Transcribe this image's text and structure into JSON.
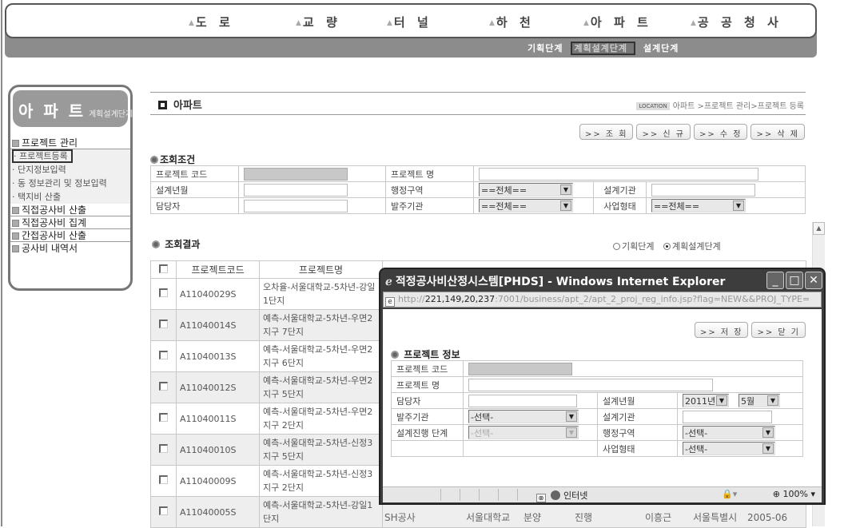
{
  "top_nav": {
    "items": [
      "도 로",
      "교 량",
      "터 널",
      "하 천",
      "아 파 트",
      "공 공 청 사"
    ],
    "phases": [
      "기획단계",
      "계획설계단계",
      "설계단계"
    ],
    "active_phase": "계획설계단계"
  },
  "sidebar": {
    "title": "아 파 트",
    "subtitle": "계획설계단계",
    "groups": [
      {
        "label": "프로젝트 관리",
        "items": [
          "프로젝트등록",
          "단지정보입력",
          "동 정보관리 및 정보입력",
          "택지비 산출"
        ],
        "selected": "프로젝트등록"
      },
      {
        "label": "직접공사비 산출",
        "items": []
      },
      {
        "label": "직접공사비 집계",
        "items": []
      },
      {
        "label": "간접공사비 산출",
        "items": []
      },
      {
        "label": "공사비 내역서",
        "items": []
      }
    ]
  },
  "page": {
    "title": "아파트",
    "location_badge": "LOCATION",
    "breadcrumb": "아파트 >프로젝트 관리>프로젝트 등록",
    "buttons": {
      "search": ">> 조 회",
      "new": ">> 신 규",
      "edit": ">> 수 정",
      "delete": ">> 삭 제"
    }
  },
  "search": {
    "section_label": "조회조건",
    "fields": {
      "project_code_label": "프로젝트 코드",
      "project_name_label": "프로젝트 명",
      "design_yearmonth_label": "설계년월",
      "admin_region_label": "행정구역",
      "admin_region_value": "==전체==",
      "design_org_label": "설계기관",
      "manager_label": "담당자",
      "client_org_label": "발주기관",
      "client_org_value": "==전체==",
      "business_type_label": "사업형태",
      "business_type_value": "==전체=="
    }
  },
  "results": {
    "section_label": "조회결과",
    "radio": {
      "options": [
        "기획단계",
        "계획설계단계"
      ],
      "selected": "계획설계단계"
    },
    "columns": [
      "프로젝트코드",
      "프로젝트명"
    ],
    "rows": [
      {
        "code": "A11040029S",
        "name": "오차율-서울대학교-5차년-강일1단지"
      },
      {
        "code": "A11040014S",
        "name": "예측-서울대학교-5차년-우면2지구 7단지"
      },
      {
        "code": "A11040013S",
        "name": "예측-서울대학교-5차년-우면2지구 6단지"
      },
      {
        "code": "A11040012S",
        "name": "예측-서울대학교-5차년-우면2지구 5단지"
      },
      {
        "code": "A11040011S",
        "name": "예측-서울대학교-5차년-우면2지구 2단지"
      },
      {
        "code": "A11040010S",
        "name": "예측-서울대학교-5차년-신정3지구 5단지"
      },
      {
        "code": "A11040009S",
        "name": "예측-서울대학교-5차년-신정3지구 2단지"
      },
      {
        "code": "A11040005S",
        "name": "예측-서울대학교-5차년-강일1단지"
      }
    ],
    "last_row_extra": [
      "SH공사",
      "서울대학교",
      "분양",
      "진행",
      "이흥근",
      "서울특별시",
      "2005-06"
    ]
  },
  "popup": {
    "title": "적정공사비산정시스템[PHDS] - Windows Internet Explorer",
    "url_prefix": "http://",
    "url_host": "221,149,20,237",
    "url_rest": ":7001/business/apt_2/apt_2_proj_reg_info.jsp?flag=NEW&&PROJ_TYPE=",
    "buttons": {
      "save": ">> 저 장",
      "close": ">> 닫 기"
    },
    "section_label": "프로젝트 정보",
    "fields": {
      "project_code_label": "프로젝트 코드",
      "project_name_label": "프로젝트 명",
      "manager_label": "담당자",
      "design_yearmonth_label": "설계년월",
      "year_value": "2011년",
      "month_value": "5월",
      "client_org_label": "발주기관",
      "client_org_value": "-선택-",
      "design_org_label": "설계기관",
      "design_phase_label": "설계진행 단계",
      "design_phase_value": "-선택-",
      "admin_region_label": "행정구역",
      "admin_region_value": "-선택-",
      "business_type_label": "사업형태",
      "business_type_value": "-선택-"
    },
    "status": {
      "zone": "인터넷",
      "zoom": "100%"
    }
  }
}
